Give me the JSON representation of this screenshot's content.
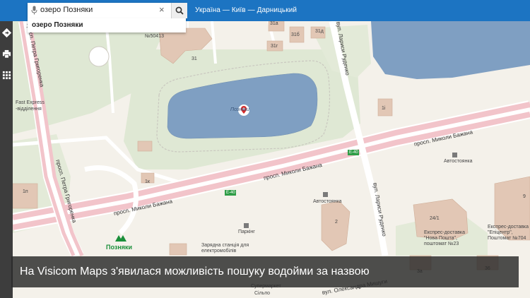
{
  "search": {
    "query": "озеро Позняки",
    "suggestion": "озеро Позняки"
  },
  "breadcrumb": "Україна — Київ — Дарницький",
  "caption": "На Visicom Maps з'явилася можливість пошуку водойми за назвою",
  "map": {
    "roads": {
      "bazhana_1": "просп. Миколи Бажана",
      "bazhana_2": "просп. Миколи Бажана",
      "bazhana_3": "просп. Миколи Бажана",
      "hryhorenka_1": "просп. Петра Григоренка",
      "hryhorenka_2": "просп. Петра Григоренка",
      "rudenko": "вул. Лариси Руденко",
      "rudenko_top": "вул. Лариси Руденко",
      "myshuhy": "вул. Олександра Мишуги"
    },
    "labels": {
      "n31": "31",
      "n31a": "31а",
      "n31b": "31б",
      "n31d": "31д",
      "n31g": "31г",
      "n1i": "1і",
      "n1k": "1к",
      "n1p": "1п",
      "n2": "2",
      "n24_1": "24/1",
      "n3a": "3а",
      "n36": "36",
      "n9": "9",
      "n50413": "№50413",
      "parking1": "Автостоянка",
      "parking2": "Автостоянка",
      "parking3": "Паркінг",
      "ev": "Зарядна станція для електромобілів",
      "express1": "Експрес-доставка \"Нова Пошта\", поштомат №23",
      "express2": "Експрес-доставка \"Епіцентр\", Поштомат №704",
      "fast": "Fast Express",
      "fast_sub": "-відділення",
      "lake": "Позняки",
      "e40_1": "Е-40",
      "e40_2": "Е-40",
      "bottom1": "Супермаркет",
      "bottom2": "Сільпо"
    },
    "metro": "Позняки"
  },
  "colors": {
    "accent": "#1c74c2",
    "water": "#7f9fc2",
    "road": "#f2c4ca",
    "building": "#e2c7b5",
    "park": "#dfe8d4"
  }
}
